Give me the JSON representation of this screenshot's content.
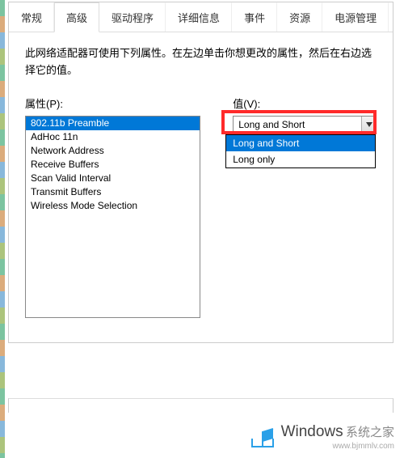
{
  "tabs": {
    "general": "常规",
    "advanced": "高级",
    "driver": "驱动程序",
    "details": "详细信息",
    "events": "事件",
    "resources": "资源",
    "power": "电源管理"
  },
  "description": "此网络适配器可使用下列属性。在左边单击你想更改的属性，然后在右边选择它的值。",
  "labels": {
    "property": "属性(P):",
    "value": "值(V):"
  },
  "property_list": [
    "802.11b Preamble",
    "AdHoc 11n",
    "Network Address",
    "Receive Buffers",
    "Scan Valid Interval",
    "Transmit Buffers",
    "Wireless Mode Selection"
  ],
  "property_selected_index": 0,
  "value_dropdown": {
    "display": "Long and Short",
    "options": [
      "Long and Short",
      "Long only"
    ],
    "selected_index": 0
  },
  "watermark": {
    "brand": "Windows",
    "sub": "系统之家",
    "url": "www.bjmmlv.com"
  }
}
